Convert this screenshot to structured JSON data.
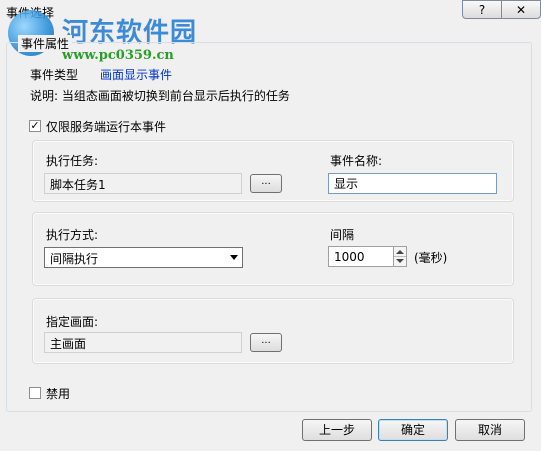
{
  "window": {
    "title": "事件选择",
    "help_label": "?",
    "close_label": "✕"
  },
  "watermark": {
    "site_name": "河东软件园",
    "url": "www.pc0359.cn"
  },
  "group": {
    "title": "事件属性"
  },
  "event": {
    "type_label": "事件类型",
    "type_value": "画面显示事件",
    "description": "说明: 当组态画面被切换到前台显示后执行的任务"
  },
  "server_only": {
    "label": "仅限服务端运行本事件",
    "checked": true
  },
  "task": {
    "label": "执行任务:",
    "value": "脚本任务1",
    "browse_label": "...",
    "name_label": "事件名称:",
    "name_value": "显示"
  },
  "mode": {
    "label": "执行方式:",
    "selected": "间隔执行",
    "interval_label": "间隔",
    "interval_value": "1000",
    "unit": "(毫秒)"
  },
  "screen": {
    "label": "指定画面:",
    "value": "主画面",
    "browse_label": "..."
  },
  "disable": {
    "label": "禁用",
    "checked": false
  },
  "footer": {
    "prev_label": "上一步",
    "ok_label": "确定",
    "cancel_label": "取消"
  }
}
